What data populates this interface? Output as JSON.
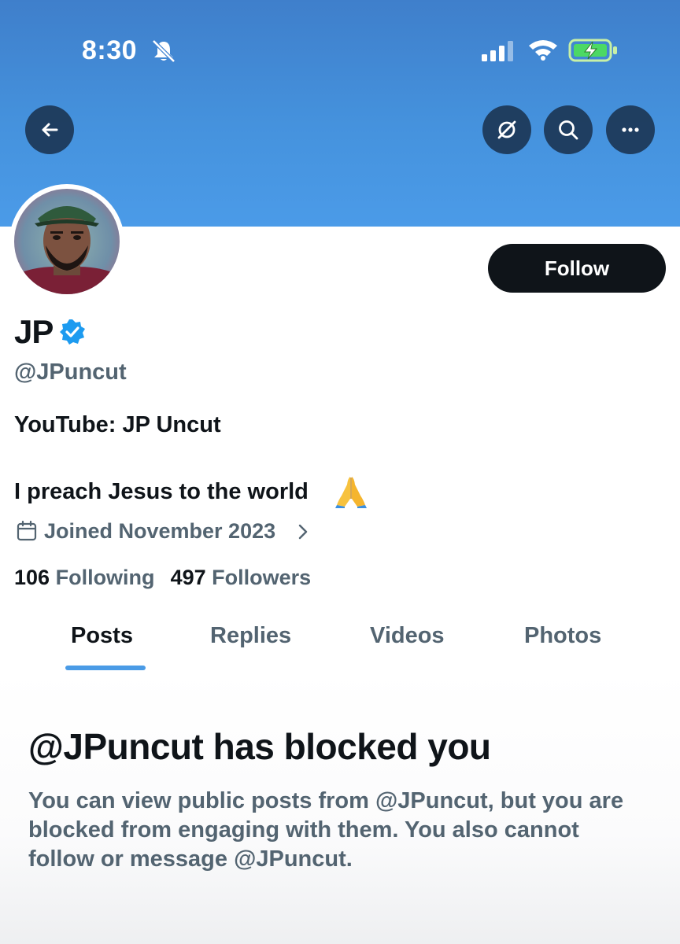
{
  "status_bar": {
    "time": "8:30",
    "silent_icon": "bell-slash-icon",
    "signal_icon": "cellular-signal-icon",
    "wifi_icon": "wifi-icon",
    "battery_icon": "battery-charging-icon"
  },
  "header": {
    "back_icon": "arrow-left-icon",
    "grok_icon": "grok-icon",
    "search_icon": "search-icon",
    "more_icon": "more-horizontal-icon"
  },
  "profile": {
    "display_name": "JP",
    "verified_icon": "verified-badge-icon",
    "handle": "@JPuncut",
    "bio_line1": "YouTube: JP Uncut",
    "bio_line2": "I preach Jesus to the world",
    "bio_emoji_icon": "folded-hands-emoji",
    "joined": "Joined November 2023",
    "following_count": "106",
    "following_label": "Following",
    "followers_count": "497",
    "followers_label": "Followers",
    "follow_button": "Follow"
  },
  "tabs": [
    {
      "label": "Posts",
      "active": true
    },
    {
      "label": "Replies",
      "active": false
    },
    {
      "label": "Videos",
      "active": false
    },
    {
      "label": "Photos",
      "active": false
    }
  ],
  "blocked": {
    "title": "@JPuncut has blocked you",
    "message": "You can view public posts from @JPuncut, but you are blocked from engaging with them. You also cannot follow or message @JPuncut."
  },
  "colors": {
    "banner": "#4592dd",
    "accent": "#1d9bf0",
    "text_primary": "#0f1419",
    "text_secondary": "#536471"
  }
}
